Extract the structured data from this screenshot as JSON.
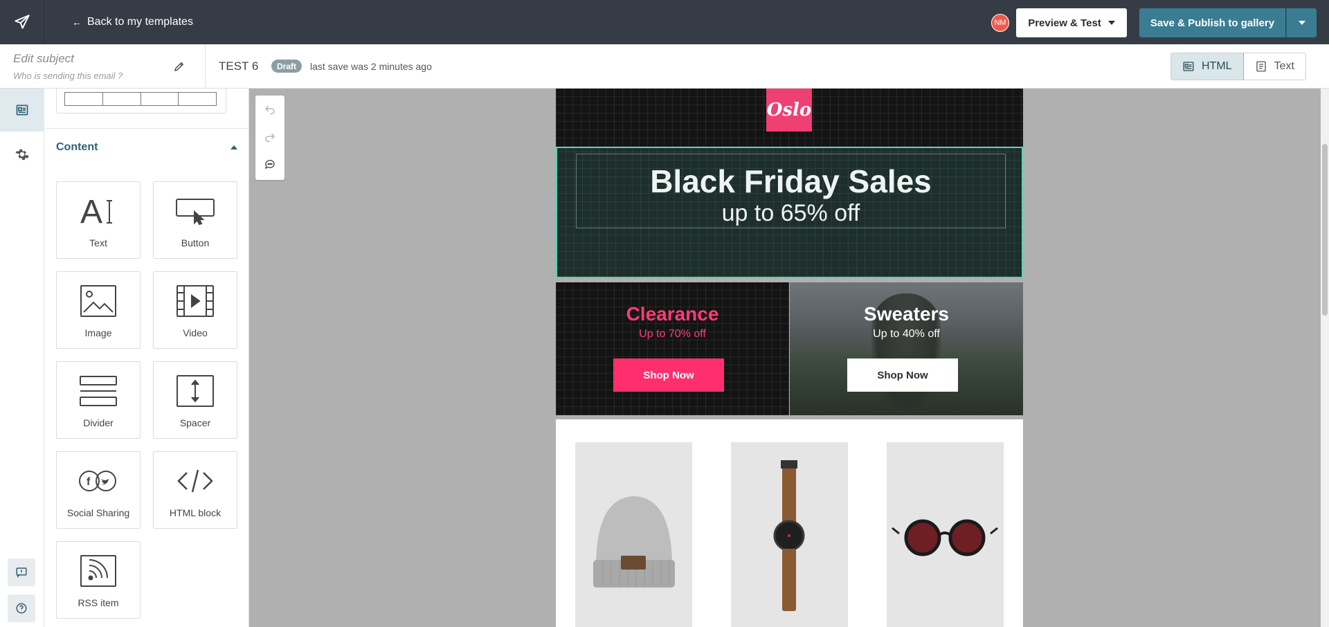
{
  "topbar": {
    "back_label": "Back to my templates",
    "avatar_initials": "NM",
    "preview_label": "Preview & Test",
    "publish_label": "Save & Publish to gallery"
  },
  "subject": {
    "placeholder": "Edit subject",
    "sender_placeholder": "Who is sending this email ?"
  },
  "template": {
    "name": "TEST 6",
    "status_badge": "Draft",
    "save_status": "last save was 2 minutes ago"
  },
  "mode_toggle": {
    "html_label": "HTML",
    "text_label": "Text",
    "active": "HTML"
  },
  "panel": {
    "section_title": "Content",
    "blocks": [
      {
        "label": "Text",
        "icon": "text-block-icon"
      },
      {
        "label": "Button",
        "icon": "button-block-icon"
      },
      {
        "label": "Image",
        "icon": "image-block-icon"
      },
      {
        "label": "Video",
        "icon": "video-block-icon"
      },
      {
        "label": "Divider",
        "icon": "divider-block-icon"
      },
      {
        "label": "Spacer",
        "icon": "spacer-block-icon"
      },
      {
        "label": "Social Sharing",
        "icon": "social-sharing-icon"
      },
      {
        "label": "HTML block",
        "icon": "code-icon"
      },
      {
        "label": "RSS item",
        "icon": "rss-icon"
      }
    ]
  },
  "email": {
    "logo_text": "Oslo",
    "hero_title": "Black Friday Sales",
    "hero_subtitle": "up to 65% off",
    "promos": [
      {
        "title": "Clearance",
        "subtitle": "Up to 70% off",
        "button": "Shop Now"
      },
      {
        "title": "Sweaters",
        "subtitle": "Up to 40% off",
        "button": "Shop Now"
      }
    ],
    "products": [
      "beanie",
      "wristwatch",
      "sunglasses"
    ]
  },
  "colors": {
    "topbar_bg": "#363c45",
    "publish_bg": "#3a7d93",
    "brand_pink": "#ef3f73",
    "selection_outline": "#5fd1b2",
    "accent_blue": "#2f5f78"
  }
}
